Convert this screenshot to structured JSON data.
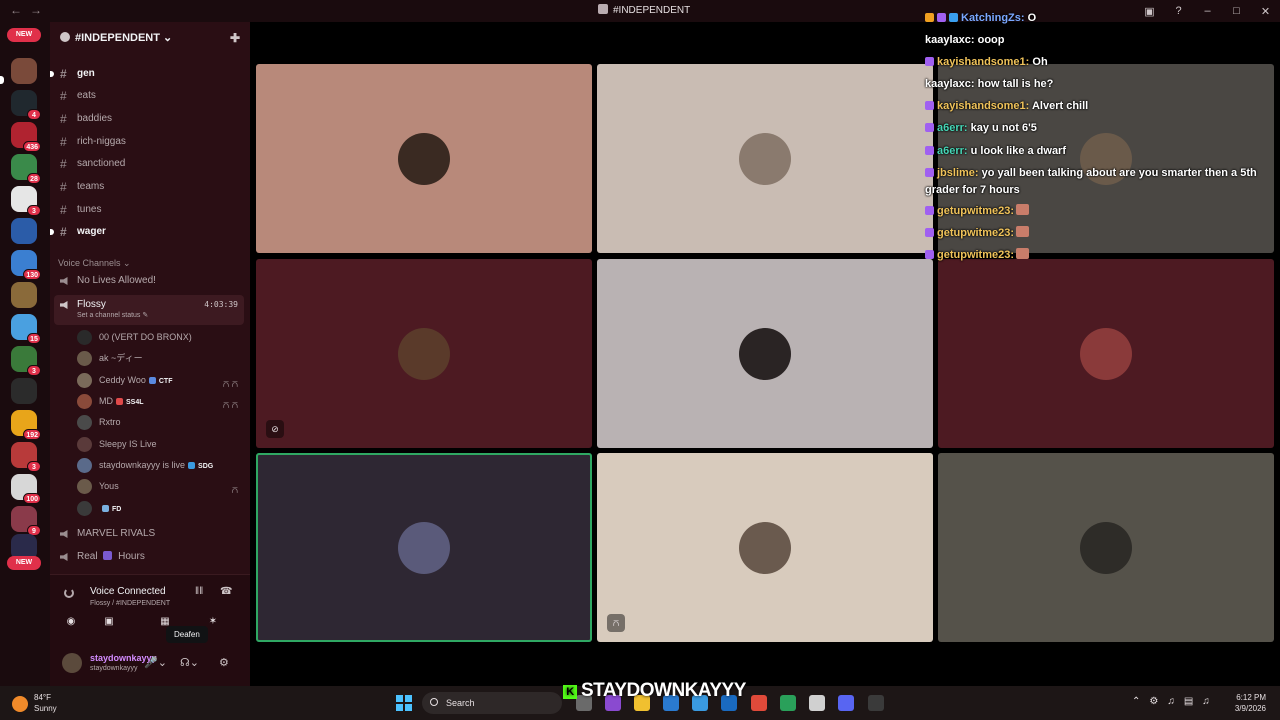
{
  "window": {
    "title": "#INDEPENDENT"
  },
  "servers": [
    {
      "badge": ""
    },
    {
      "badge": ""
    },
    {
      "badge": "4"
    },
    {
      "badge": "436"
    },
    {
      "badge": "28"
    },
    {
      "badge": "3"
    },
    {
      "badge": ""
    },
    {
      "badge": "130"
    },
    {
      "badge": ""
    },
    {
      "badge": "15"
    },
    {
      "badge": "3"
    },
    {
      "badge": ""
    },
    {
      "badge": "192"
    },
    {
      "badge": "3"
    },
    {
      "badge": "100"
    },
    {
      "badge": "9"
    },
    {
      "badge": ""
    }
  ],
  "rail": {
    "new_top": "NEW",
    "new_bottom": "NEW"
  },
  "server_header": {
    "name": "#INDEPENDENT"
  },
  "text_channels": [
    "gen",
    "eats",
    "baddies",
    "rich-niggas",
    "sanctioned",
    "teams",
    "tunes",
    "wager"
  ],
  "voice": {
    "header": "Voice Channels",
    "no_lives": "No Lives Allowed!",
    "active_name": "Flossy",
    "active_timer": "4:03:39",
    "active_status": "Set a channel status",
    "marvel": "MARVEL RIVALS",
    "real": "Real",
    "hours": "Hours"
  },
  "members": [
    {
      "name": "00 (VERT DO BRONX)",
      "tag": ""
    },
    {
      "name": "ak ~ディー",
      "tag": ""
    },
    {
      "name": "Ceddy Woo",
      "tag": "CTF"
    },
    {
      "name": "MD",
      "tag": "SS4L"
    },
    {
      "name": "Rxtro",
      "tag": ""
    },
    {
      "name": "Sleepy IS Live",
      "tag": ""
    },
    {
      "name": "staydownkayyy is live",
      "tag": "SDG"
    },
    {
      "name": "Yous",
      "tag": ""
    },
    {
      "name": "",
      "tag": "FD"
    }
  ],
  "voice_panel": {
    "title": "Voice Connected",
    "subtitle": "Flossy / #INDEPENDENT",
    "tooltip": "Deafen"
  },
  "user": {
    "display_name": "staydownkayyy",
    "username": "staydownkayyy"
  },
  "chat": [
    {
      "user": "KatchingZs:",
      "text": "O",
      "color": "#7aa7ff"
    },
    {
      "user": "kaaylaxc:",
      "text": "ooop",
      "color": "#ffffff"
    },
    {
      "user": "kayishandsome1:",
      "text": "Oh",
      "color": "#f0c35a"
    },
    {
      "user": "kaaylaxc:",
      "text": "how tall is he?",
      "color": "#ffffff"
    },
    {
      "user": "kayishandsome1:",
      "text": "Alvert chill",
      "color": "#f0c35a"
    },
    {
      "user": "a6err:",
      "text": "kay u not 6'5",
      "color": "#46d6b6"
    },
    {
      "user": "a6err:",
      "text": "u look like a dwarf",
      "color": "#46d6b6"
    },
    {
      "user": "jbslime:",
      "text": "yo yall been talking about are you smarter then a 5th grader for 7 hours",
      "color": "#f0c35a"
    },
    {
      "user": "getupwitme23:",
      "text": "",
      "color": "#f0c35a"
    },
    {
      "user": "getupwitme23:",
      "text": "",
      "color": "#f0c35a"
    },
    {
      "user": "getupwitme23:",
      "text": "",
      "color": "#f0c35a"
    }
  ],
  "watermark": "STAYDOWNKAYYY",
  "taskbar": {
    "temp": "84°F",
    "condition": "Sunny",
    "search": "Search",
    "time": "6:12 PM",
    "date": "3/9/2026"
  },
  "tiles": [
    {
      "bg": "#b8897a"
    },
    {
      "bg": "#c9bcb3"
    },
    {
      "bg": "#4a4743"
    },
    {
      "bg": "#4d1a22"
    },
    {
      "bg": "#b9b2b3"
    },
    {
      "bg": "#4d1a22"
    },
    {
      "bg": "#2e2733"
    },
    {
      "bg": "#d8cbbd"
    },
    {
      "bg": "#55524a"
    }
  ]
}
